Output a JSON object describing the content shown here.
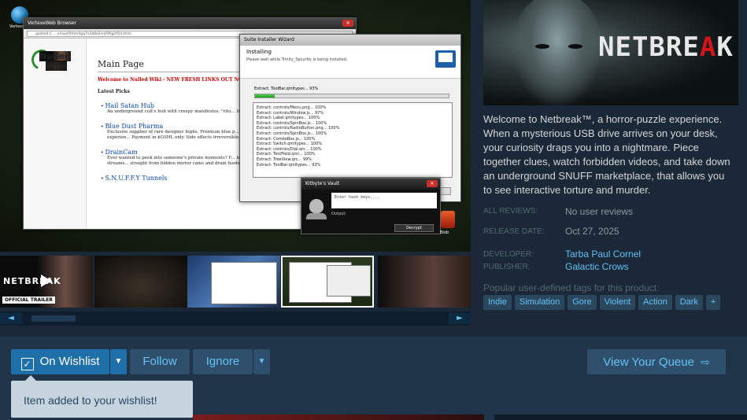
{
  "media": {
    "desktop_icon_label": "VortexeWeb",
    "browser": {
      "title": "VortexeWeb Browser",
      "url": "gashell://.....vl/aye5hhm4gq7x1b8o2vnjf96g2t5d.html",
      "logo_line1": "Nulled",
      "logo_line2": "Wiki",
      "page_title": "Main Page",
      "welcome": "Welcome to Nulled Wiki - NEW FRESH LINKS OUT NOW!!",
      "latest_heading": "Latest Picks",
      "items": [
        {
          "title": "Hail Satan Hub",
          "desc": "An underground cult's hub with creepy manifestos, \"ritu... livestreams,\" and encrypted \"confessions.\""
        },
        {
          "title": "Blue Dust Pharma",
          "desc": "Exclusive supplier of rare designer highs. Premium blue p... blends, custom capsules, and bespoke chemical experien... Payment in $GSHL only. Side effects irreversible."
        },
        {
          "title": "DrainCam",
          "desc": "Ever wanted to peek into someone's private moments? F... brushing teeth to bathroom breaks. Drain Cams streams... straight from hidden mirror cams and drain feeds."
        },
        {
          "title": "S.N.U.F.F.Y Tunnels",
          "desc": ""
        }
      ]
    },
    "installer": {
      "title": "Suite Installer Wizard",
      "heading": "Installing",
      "subheading": "Please wait while Trinity_Security is being installed.",
      "status": "Extract: ToolBar.qmltypes... 93%",
      "progress": 0.1,
      "log": [
        "Extract: controls/Menu.png... 100%",
        "Extract: controls/Window.js... 97%",
        "Extract: Label.qmltypes... 100%",
        "Extract: controls/SpinBox.js... 100%",
        "Extract: controls/RadioButton.png... 100%",
        "Extract: controls/SpinBox.js... 100%",
        "Extract: ComboBox.js... 100%",
        "Extract: Switch.qmltypes... 100%",
        "Extract: controls/Dial.qrc... 100%",
        "Extract: TextField.qml... 100%",
        "Extract: TreeView.qrc... 99%",
        "Extract: ToolBar.qmltypes... 93%"
      ]
    },
    "vault": {
      "title": "Kitbyte's Vault",
      "placeholder": "Enter hash keys....",
      "output_label": "Output:",
      "button": "Decrypt"
    },
    "blob_label": "Blob"
  },
  "thumbnails": {
    "trailer_logo": "NETBREAK",
    "trailer_badge": "OFFICIAL TRAILER"
  },
  "scroller": {
    "left": "◄",
    "right": "►"
  },
  "capsule": {
    "title_a": "NETBRE",
    "title_b": "A",
    "title_c": "K"
  },
  "description": "Welcome to Netbreak™, a horror-puzzle experience. When a mysterious USB drive arrives on your desk, your curiosity drags you into a nightmare. Piece together clues, watch forbidden videos, and take down an underground SNUFF marketplace, that allows you to see interactive torture and murder.",
  "meta": {
    "reviews_label": "ALL REVIEWS:",
    "reviews_value": "No user reviews",
    "release_label": "RELEASE DATE:",
    "release_value": "Oct 27, 2025",
    "developer_label": "DEVELOPER:",
    "developer_value": "Tarba Paul Cornel",
    "publisher_label": "PUBLISHER:",
    "publisher_value": "Galactic Crows"
  },
  "tags": {
    "label": "Popular user-defined tags for this product:",
    "items": [
      "Indie",
      "Simulation",
      "Gore",
      "Violent",
      "Action",
      "Dark",
      "+"
    ]
  },
  "actions": {
    "wishlist_check": "✓",
    "wishlist": "On Wishlist",
    "dropdown": "▼",
    "follow": "Follow",
    "ignore": "Ignore",
    "queue": "View Your Queue",
    "queue_arrow": "⇨"
  },
  "tooltip": "Item added to your wishlist!",
  "colors": {
    "accent": "#67c1f5",
    "background": "#1b2838",
    "wishlist_active": "#1f6fa8"
  }
}
